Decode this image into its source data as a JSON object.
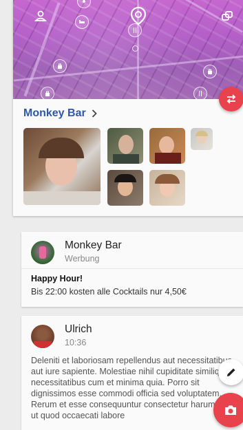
{
  "map": {
    "header_icons": [
      "user-icon",
      "map-pin-icon",
      "switch-icon"
    ],
    "poi_icons": [
      "hotel-icon",
      "shopping-icon",
      "restaurant-icon",
      "shopping-icon",
      "shopping-icon",
      "restaurant-icon",
      "place-icon"
    ]
  },
  "venue": {
    "name": "Monkey Bar",
    "photos_count": 6
  },
  "posts": [
    {
      "name": "Monkey Bar",
      "subtitle": "Werbung",
      "headline": "Happy Hour!",
      "text": "Bis 22:00 kosten alle Cocktails nur 4,50€"
    },
    {
      "name": "Ulrich",
      "time": "10:36",
      "body": "Deleniti et laboriosam repellendus aut necessitatibus aut iure sapiente. Molestiae nihil cupiditate similique necessitatibus cum et minima quia. Porro sit dignissimos esse commodi officia sed voluptatem. Rerum et esse consequuntur consectetur harum sed ut quod occaecati labore"
    }
  ],
  "colors": {
    "accent": "#e8434d",
    "link": "#2e57a6",
    "map_tint": "#b460c8"
  },
  "actions": [
    "swap-icon",
    "pencil-icon",
    "camera-icon"
  ]
}
